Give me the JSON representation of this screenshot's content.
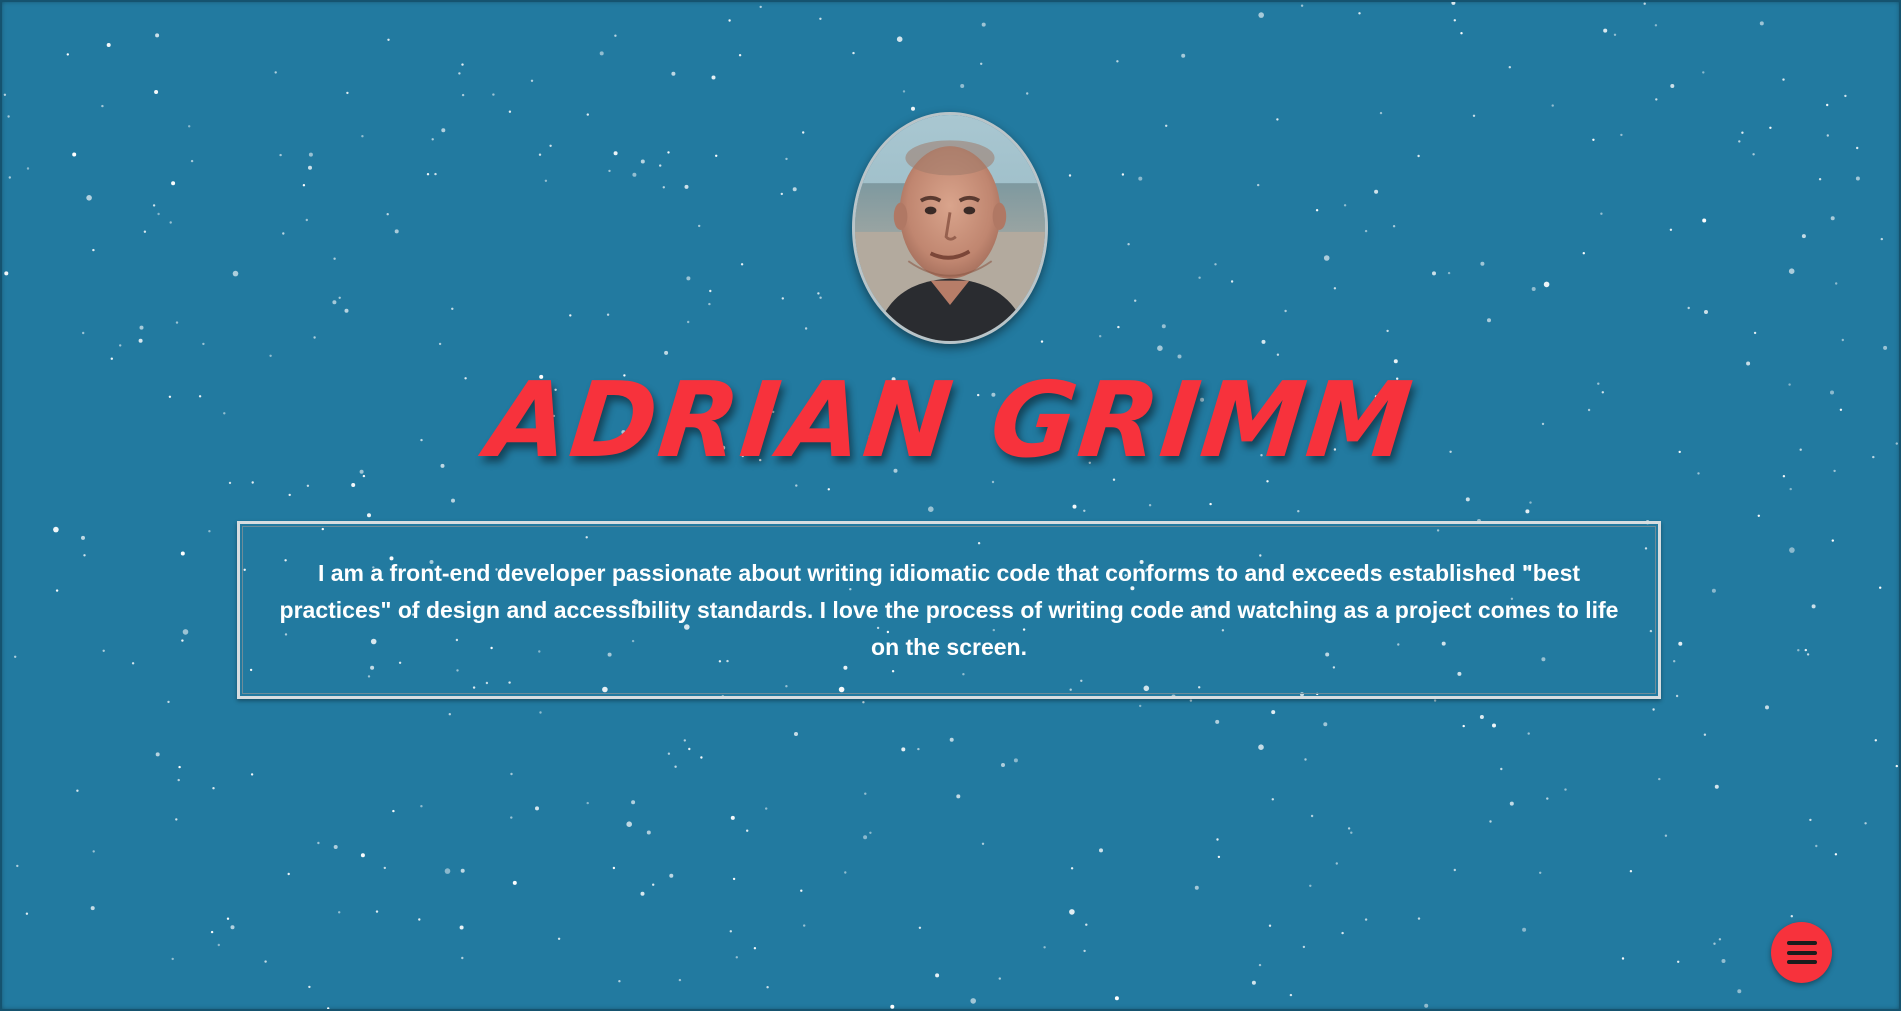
{
  "profile": {
    "name": "ADRIAN GRIMM",
    "avatar_alt": "Adrian Grimm portrait",
    "bio": "I am a front-end developer passionate about writing idiomatic code that conforms to and exceeds established \"best practices\" of design and accessibility standards. I love the process of writing code and watching as a project comes to life on the screen."
  },
  "menu": {
    "icon": "hamburger-menu-icon",
    "aria_label": "Open menu"
  },
  "colors": {
    "background": "#227aa0",
    "accent": "#f7323c",
    "text": "#ffffff",
    "box_border": "#d7dde0"
  }
}
